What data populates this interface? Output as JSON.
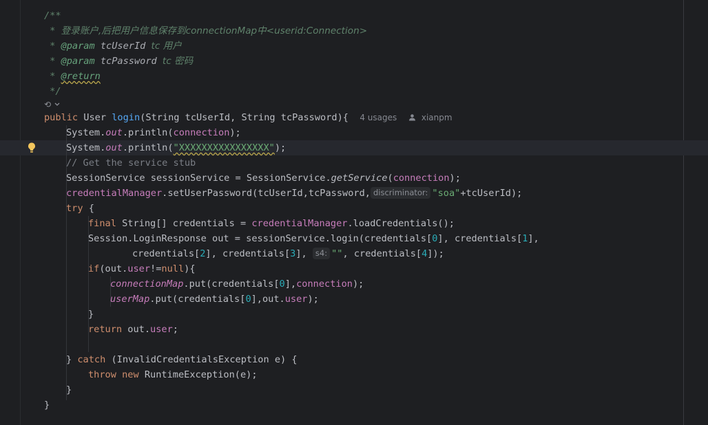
{
  "editor": {
    "doc_comment": {
      "open": "/**",
      "line1_prefix": " * ",
      "line1_text": "登录账户,后把用户信息保存到connectionMap中<userid:Connection>",
      "param1_tag": "@param",
      "param1_name": "tcUserId",
      "param1_desc": "tc 用户",
      "param2_tag": "@param",
      "param2_name": "tcPassword",
      "param2_desc": "tc 密码",
      "return_tag": "@return",
      "close": " */"
    },
    "method_sig": {
      "kw_public": "public",
      "type": "User",
      "name": "login",
      "params": "(String tcUserId, String tcPassword){",
      "usages": "4 usages",
      "author": "xianpm"
    },
    "lines": {
      "l1_sys": "System.",
      "l1_out": "out",
      "l1_rest": ".println(",
      "l1_arg": "connection",
      "l1_end": ");",
      "l2_sys": "System.",
      "l2_out": "out",
      "l2_rest": ".println(",
      "l2_str": "\"XXXXXXXXXXXXXXXX\"",
      "l2_end": ");",
      "l3_comment": "// Get the service stub",
      "l4_a": "SessionService sessionService = SessionService.",
      "l4_fn": "getService",
      "l4_b": "(",
      "l4_arg": "connection",
      "l4_end": ");",
      "l5_field": "credentialManager",
      "l5_a": ".setUserPassword(tcUserId,tcPassword,",
      "l5_hint": "discriminator:",
      "l5_str": "\"soa\"",
      "l5_end": "+tcUserId);",
      "l6_try": "try",
      "l6_brace": " {",
      "l7_final": "final",
      "l7_a": " String[] credentials = ",
      "l7_field": "credentialManager",
      "l7_b": ".loadCredentials();",
      "l8_a": "Session.LoginResponse out = sessionService.login(credentials[",
      "l8_n0": "0",
      "l8_b": "], credentials[",
      "l8_n1": "1",
      "l8_c": "],",
      "l9_a": "credentials[",
      "l9_n2": "2",
      "l9_b": "], credentials[",
      "l9_n3": "3",
      "l9_c": "],",
      "l9_hint": "s4:",
      "l9_str": "\"\"",
      "l9_d": ", credentials[",
      "l9_n4": "4",
      "l9_e": "]);",
      "l10_if": "if",
      "l10_a": "(out.",
      "l10_user": "user",
      "l10_b": "!=",
      "l10_null": "null",
      "l10_c": "){",
      "l11_map": "connectionMap",
      "l11_a": ".put(credentials[",
      "l11_n": "0",
      "l11_b": "],",
      "l11_conn": "connection",
      "l11_c": ");",
      "l12_map": "userMap",
      "l12_a": ".put(credentials[",
      "l12_n": "0",
      "l12_b": "],out.",
      "l12_user": "user",
      "l12_c": ");",
      "l13": "}",
      "l14_return": "return",
      "l14_a": " out.",
      "l14_user": "user",
      "l14_b": ";",
      "l15_close": "} ",
      "l15_catch": "catch",
      "l15_a": " (InvalidCredentialsException e) {",
      "l16_throw": "throw",
      "l16_new": "new",
      "l16_a": " RuntimeException(e);",
      "l17": "}",
      "l18": "}"
    }
  },
  "colors": {
    "background": "#1e1f22",
    "keyword": "#cf8e6d",
    "function": "#56a8f5",
    "field": "#c77dbb",
    "string": "#6aab73",
    "number": "#2aacb8",
    "comment": "#5f826b",
    "text": "#bcbec4"
  },
  "icons": [
    "intention-bulb-icon",
    "fold-icon",
    "user-icon"
  ]
}
